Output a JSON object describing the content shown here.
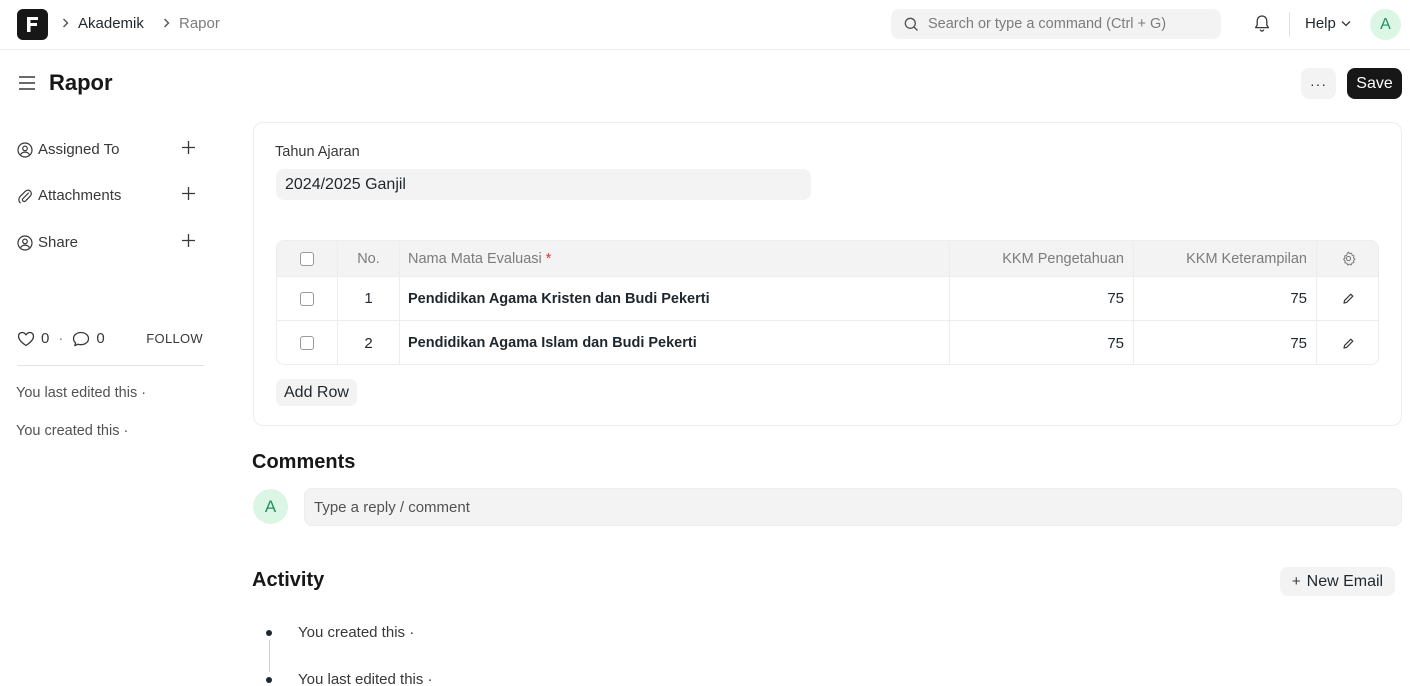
{
  "navbar": {
    "breadcrumbs": [
      "Akademik",
      "Rapor"
    ],
    "search_placeholder": "Search or type a command (Ctrl + G)",
    "help_label": "Help",
    "avatar_initial": "A"
  },
  "page": {
    "title": "Rapor",
    "more_label": "···",
    "save_label": "Save"
  },
  "sidebar": {
    "items": [
      {
        "label": "Assigned To",
        "icon": "user-check-icon"
      },
      {
        "label": "Attachments",
        "icon": "paperclip-icon"
      },
      {
        "label": "Share",
        "icon": "share-user-icon"
      }
    ],
    "likes_count": "0",
    "comments_count": "0",
    "dot": "·",
    "follow_label": "FOLLOW",
    "last_edited": "You last edited this ·",
    "created": "You created this ·"
  },
  "form": {
    "field_label": "Tahun Ajaran",
    "field_value": "2024/2025 Ganjil",
    "table": {
      "headers": {
        "no": "No.",
        "name": "Nama Mata Evaluasi",
        "required_mark": "*",
        "kkm_pengetahuan": "KKM Pengetahuan",
        "kkm_keterampilan": "KKM Keterampilan"
      },
      "rows": [
        {
          "no": "1",
          "name": "Pendidikan Agama Kristen dan Budi Pekerti",
          "kkm_pengetahuan": "75",
          "kkm_keterampilan": "75"
        },
        {
          "no": "2",
          "name": "Pendidikan Agama Islam dan Budi Pekerti",
          "kkm_pengetahuan": "75",
          "kkm_keterampilan": "75"
        }
      ]
    },
    "add_row_label": "Add Row"
  },
  "comments": {
    "title": "Comments",
    "avatar_initial": "A",
    "placeholder": "Type a reply / comment"
  },
  "activity": {
    "title": "Activity",
    "new_email_plus": "+",
    "new_email_label": "New Email",
    "entries": [
      "You created this ·",
      "You last edited this ·"
    ]
  },
  "colors": {
    "primary_dark": "#171717",
    "control_bg": "#f3f3f3",
    "border": "#ededed",
    "avatar_bg": "#dcf6e6",
    "avatar_fg": "#278f5e",
    "required": "#e03636"
  }
}
